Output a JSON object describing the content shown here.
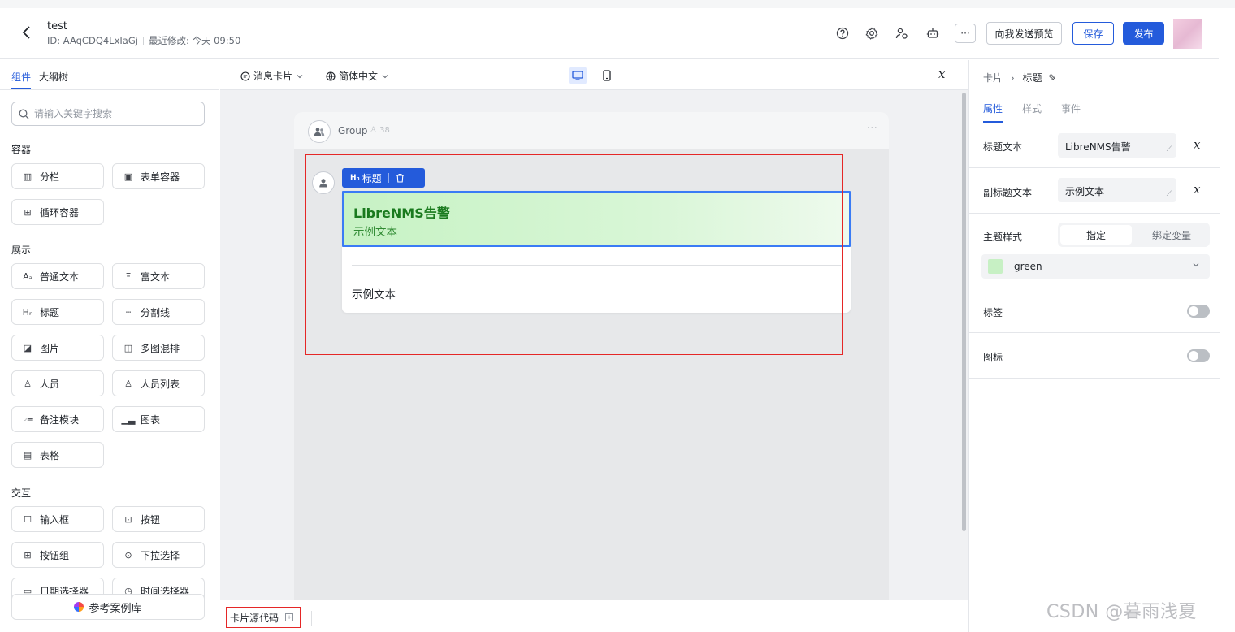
{
  "header": {
    "title": "test",
    "id_text": "ID: AAqCDQ4LxIaGj",
    "modified_text": "最近修改: 今天 09:50",
    "more_label": "···",
    "preview_label": "向我发送预览",
    "save_label": "保存",
    "publish_label": "发布"
  },
  "left": {
    "tabs": [
      "组件",
      "大纲树"
    ],
    "search_placeholder": "请输入关键字搜索",
    "sections": {
      "container": "容器",
      "display": "展示",
      "interact": "交互"
    },
    "components": {
      "columns": "分栏",
      "form_container": "表单容器",
      "loop_container": "循环容器",
      "plain_text": "普通文本",
      "rich_text": "富文本",
      "heading": "标题",
      "divider": "分割线",
      "image": "图片",
      "multi_image": "多图混排",
      "person": "人员",
      "person_list": "人员列表",
      "note": "备注模块",
      "chart": "图表",
      "table": "表格",
      "input": "输入框",
      "button": "按钮",
      "button_group": "按钮组",
      "dropdown": "下拉选择",
      "date_picker": "日期选择器",
      "time_picker": "时间选择器"
    },
    "case_library": "参考案例库"
  },
  "center": {
    "card_type": "消息卡片",
    "language": "简体中文",
    "fx": "x",
    "group_name": "Group",
    "group_count": "38",
    "group_more": "···",
    "tag_label": "标题",
    "card_title": "LibreNMS告警",
    "card_subtitle": "示例文本",
    "card_body": "示例文本",
    "source_code": "卡片源代码"
  },
  "right": {
    "breadcrumb_root": "卡片",
    "breadcrumb_current": "标题",
    "tabs": [
      "属性",
      "样式",
      "事件"
    ],
    "title_label": "标题文本",
    "title_value": "LibreNMS告警",
    "subtitle_label": "副标题文本",
    "subtitle_value": "示例文本",
    "theme_label": "主题样式",
    "theme_options": [
      "指定",
      "绑定变量"
    ],
    "theme_color": "green",
    "theme_swatch": "#c7f0c4",
    "tag_label": "标签",
    "icon_label": "图标",
    "fx": "x"
  },
  "watermark": "CSDN @暮雨浅夏",
  "colors": {
    "accent": "#245bdb",
    "highlight_border": "#e52727",
    "card_title_green": "#1a7a1e"
  }
}
